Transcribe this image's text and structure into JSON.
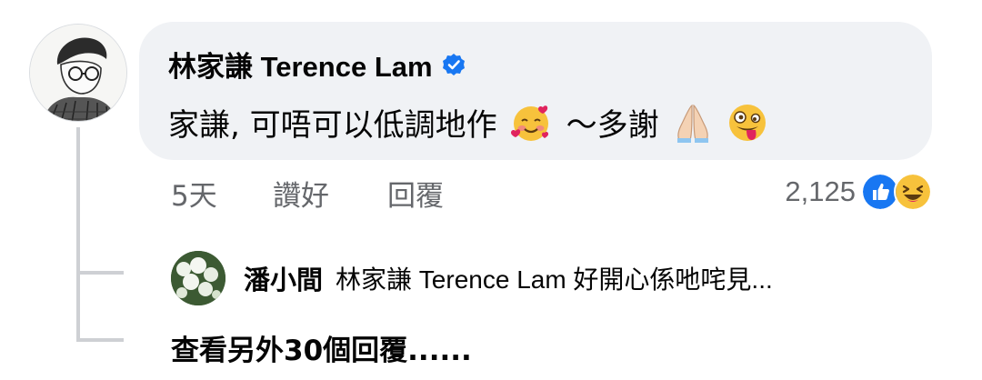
{
  "comment": {
    "author": "林家謙 Terence Lam",
    "text_main": "家謙, 可唔可以低調地作",
    "text_after": "～多謝",
    "verified_icon": "verified-badge-icon",
    "emojis": [
      "smiling-face-with-hearts",
      "folded-hands",
      "zany-face"
    ]
  },
  "meta": {
    "time": "5天",
    "like_label": "讚好",
    "reply_label": "回覆",
    "reaction_count": "2,125",
    "reaction_icons": [
      "like-icon",
      "haha-icon"
    ]
  },
  "reply": {
    "author": "潘小間",
    "text": "林家謙 Terence Lam 好開心係吔咤見..."
  },
  "more_replies": {
    "label": "查看另外30個回覆......"
  },
  "colors": {
    "bubble": "#f0f2f5",
    "secondary_text": "#65676b",
    "verified_blue": "#1877f2",
    "thread_line": "#ced0d4"
  }
}
